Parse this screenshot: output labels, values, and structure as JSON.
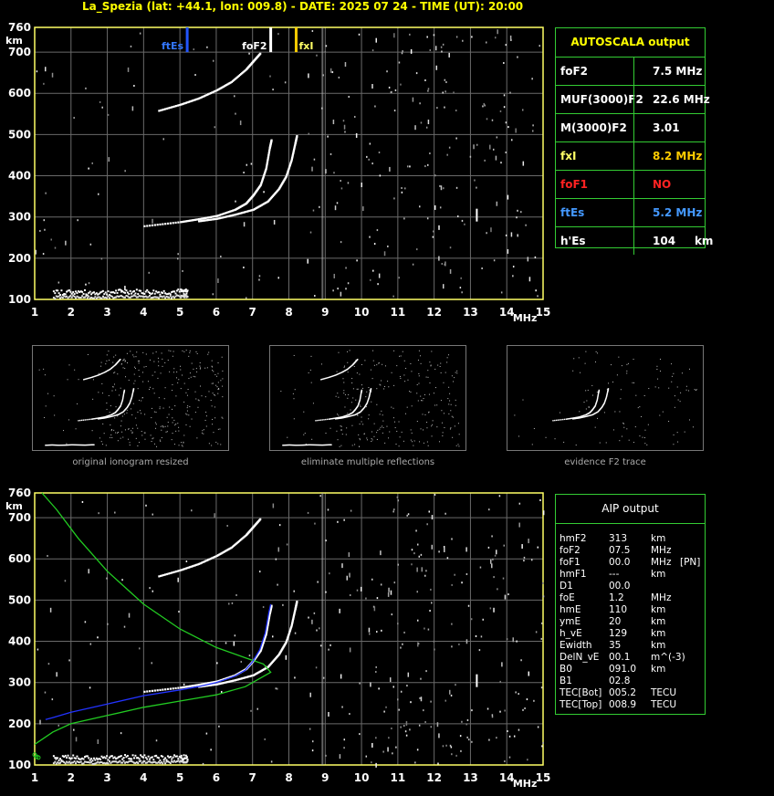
{
  "title": "La_Spezia (lat: +44.1, lon: 009.8) - DATE: 2025 07 24 - TIME (UT): 20:00",
  "colors": {
    "grid": "#6a6a6a",
    "axis": "#ffff66",
    "panel_border": "#33cc33",
    "ftEs": "#2255ff",
    "foF2": "#ffffff",
    "fxI": "#ffcc00",
    "profile_green": "#22cc22",
    "profile_blue": "#2233ff",
    "label_red": "#ff2222",
    "label_blue": "#4499ff"
  },
  "chart_data": [
    {
      "type": "scatter",
      "name": "main_ionogram",
      "xlabel": "MHz",
      "ylabel": "km",
      "xlim": [
        1,
        15
      ],
      "ylim": [
        100,
        760
      ],
      "x_ticks": [
        1,
        2,
        3,
        4,
        5,
        6,
        7,
        8,
        9,
        10,
        11,
        12,
        13,
        14,
        15
      ],
      "y_ticks": [
        100,
        200,
        300,
        400,
        500,
        600,
        700,
        760
      ],
      "grid": true,
      "markers": [
        {
          "label": "ftEs",
          "x": 5.2,
          "color": "#2255ff"
        },
        {
          "label": "foF2",
          "x": 7.5,
          "color": "#ffffff"
        },
        {
          "label": "fxI",
          "x": 8.2,
          "color": "#ffcc00"
        }
      ],
      "traces": [
        {
          "series": "F2 ordinary",
          "points": [
            [
              4.0,
              280
            ],
            [
              5.0,
              290
            ],
            [
              5.5,
              297
            ],
            [
              6.0,
              305
            ],
            [
              6.5,
              320
            ],
            [
              6.8,
              335
            ],
            [
              7.0,
              355
            ],
            [
              7.2,
              380
            ],
            [
              7.35,
              420
            ],
            [
              7.45,
              470
            ],
            [
              7.5,
              490
            ]
          ]
        },
        {
          "series": "F2 extraordinary",
          "points": [
            [
              5.5,
              292
            ],
            [
              6.0,
              298
            ],
            [
              6.5,
              308
            ],
            [
              7.0,
              320
            ],
            [
              7.4,
              340
            ],
            [
              7.7,
              370
            ],
            [
              7.9,
              400
            ],
            [
              8.05,
              440
            ],
            [
              8.15,
              480
            ],
            [
              8.2,
              500
            ]
          ]
        },
        {
          "series": "F2 second hop",
          "points": [
            [
              4.4,
              560
            ],
            [
              5.0,
              575
            ],
            [
              5.5,
              590
            ],
            [
              6.0,
              610
            ],
            [
              6.4,
              630
            ],
            [
              6.8,
              660
            ],
            [
              7.0,
              680
            ],
            [
              7.2,
              700
            ]
          ]
        },
        {
          "series": "Es",
          "points": [
            [
              1.5,
              112
            ],
            [
              2.0,
              114
            ],
            [
              2.5,
              112
            ],
            [
              3.0,
              113
            ],
            [
              3.5,
              115
            ],
            [
              4.0,
              114
            ],
            [
              4.5,
              113
            ],
            [
              5.0,
              115
            ],
            [
              5.2,
              115
            ]
          ]
        }
      ]
    },
    {
      "type": "line",
      "name": "aip_profile",
      "xlabel": "MHz",
      "ylabel": "km",
      "xlim": [
        1,
        15
      ],
      "ylim": [
        100,
        760
      ],
      "x_ticks": [
        1,
        2,
        3,
        4,
        5,
        6,
        7,
        8,
        9,
        10,
        11,
        12,
        13,
        14,
        15
      ],
      "y_ticks": [
        100,
        200,
        300,
        400,
        500,
        600,
        700,
        760
      ],
      "grid": true,
      "series": [
        {
          "color": "#22cc22",
          "points": [
            [
              1.0,
              150
            ],
            [
              1.5,
              180
            ],
            [
              2.0,
              200
            ],
            [
              3.0,
              220
            ],
            [
              4.0,
              240
            ],
            [
              5.0,
              255
            ],
            [
              6.0,
              270
            ],
            [
              6.8,
              290
            ],
            [
              7.2,
              310
            ],
            [
              7.5,
              325
            ],
            [
              7.3,
              345
            ],
            [
              6.8,
              360
            ],
            [
              6.0,
              385
            ],
            [
              5.0,
              430
            ],
            [
              4.0,
              490
            ],
            [
              3.0,
              570
            ],
            [
              2.2,
              650
            ],
            [
              1.6,
              720
            ],
            [
              1.2,
              760
            ]
          ]
        },
        {
          "color": "#2233ff",
          "points": [
            [
              1.3,
              210
            ],
            [
              1.5,
              215
            ],
            [
              2.0,
              228
            ],
            [
              3.0,
              248
            ],
            [
              4.0,
              268
            ],
            [
              5.0,
              282
            ],
            [
              5.5,
              290
            ],
            [
              6.0,
              300
            ],
            [
              6.5,
              315
            ],
            [
              6.8,
              330
            ],
            [
              7.0,
              350
            ],
            [
              7.2,
              380
            ],
            [
              7.35,
              420
            ],
            [
              7.45,
              470
            ],
            [
              7.5,
              490
            ]
          ]
        }
      ],
      "scatter_points": [
        [
          1.05,
          120
        ],
        [
          1.1,
          118
        ],
        [
          1.0,
          125
        ]
      ]
    }
  ],
  "thumbnails": [
    {
      "caption": "original ionogram resized"
    },
    {
      "caption": "eliminate multiple reflections"
    },
    {
      "caption": "evidence F2 trace"
    }
  ],
  "autoscala": {
    "title": "AUTOSCALA output",
    "rows": [
      {
        "label": "foF2",
        "value": "7.5 MHz",
        "label_color": "#ffffff",
        "value_color": "#ffffff"
      },
      {
        "label": "MUF(3000)F2",
        "value": "22.6 MHz",
        "label_color": "#ffffff",
        "value_color": "#ffffff"
      },
      {
        "label": "M(3000)F2",
        "value": "3.01",
        "label_color": "#ffffff",
        "value_color": "#ffffff"
      },
      {
        "label": "fxI",
        "value": "8.2 MHz",
        "label_color": "#ffff66",
        "value_color": "#ffcc00"
      },
      {
        "label": "foF1",
        "value": "NO",
        "label_color": "#ff2222",
        "value_color": "#ff2222"
      },
      {
        "label": "ftEs",
        "value": "5.2 MHz",
        "label_color": "#4499ff",
        "value_color": "#4499ff"
      },
      {
        "label": "h'Es",
        "value": "104     km",
        "label_color": "#ffffff",
        "value_color": "#ffffff"
      }
    ]
  },
  "aip": {
    "title": "AIP output",
    "rows": [
      {
        "name": "hmF2",
        "value": "313",
        "unit": "km",
        "extra": ""
      },
      {
        "name": "foF2",
        "value": "07.5",
        "unit": "MHz",
        "extra": ""
      },
      {
        "name": "foF1",
        "value": "00.0",
        "unit": "MHz",
        "extra": "[PN]"
      },
      {
        "name": "hmF1",
        "value": "---",
        "unit": "km",
        "extra": ""
      },
      {
        "name": "D1",
        "value": "00.0",
        "unit": "",
        "extra": ""
      },
      {
        "name": "foE",
        "value": "1.2",
        "unit": "MHz",
        "extra": ""
      },
      {
        "name": "hmE",
        "value": "110",
        "unit": "km",
        "extra": ""
      },
      {
        "name": "ymE",
        "value": "20",
        "unit": "km",
        "extra": ""
      },
      {
        "name": "h_vE",
        "value": "129",
        "unit": "km",
        "extra": ""
      },
      {
        "name": "Ewidth",
        "value": "35",
        "unit": "km",
        "extra": ""
      },
      {
        "name": "DelN_vE",
        "value": "00.1",
        "unit": "m^(-3)",
        "extra": ""
      },
      {
        "name": "B0",
        "value": "091.0",
        "unit": "km",
        "extra": ""
      },
      {
        "name": "B1",
        "value": "02.8",
        "unit": "",
        "extra": ""
      },
      {
        "name": "TEC[Bot]",
        "value": "005.2",
        "unit": "TECU",
        "extra": ""
      },
      {
        "name": "TEC[Top]",
        "value": "008.9",
        "unit": "TECU",
        "extra": ""
      }
    ]
  }
}
